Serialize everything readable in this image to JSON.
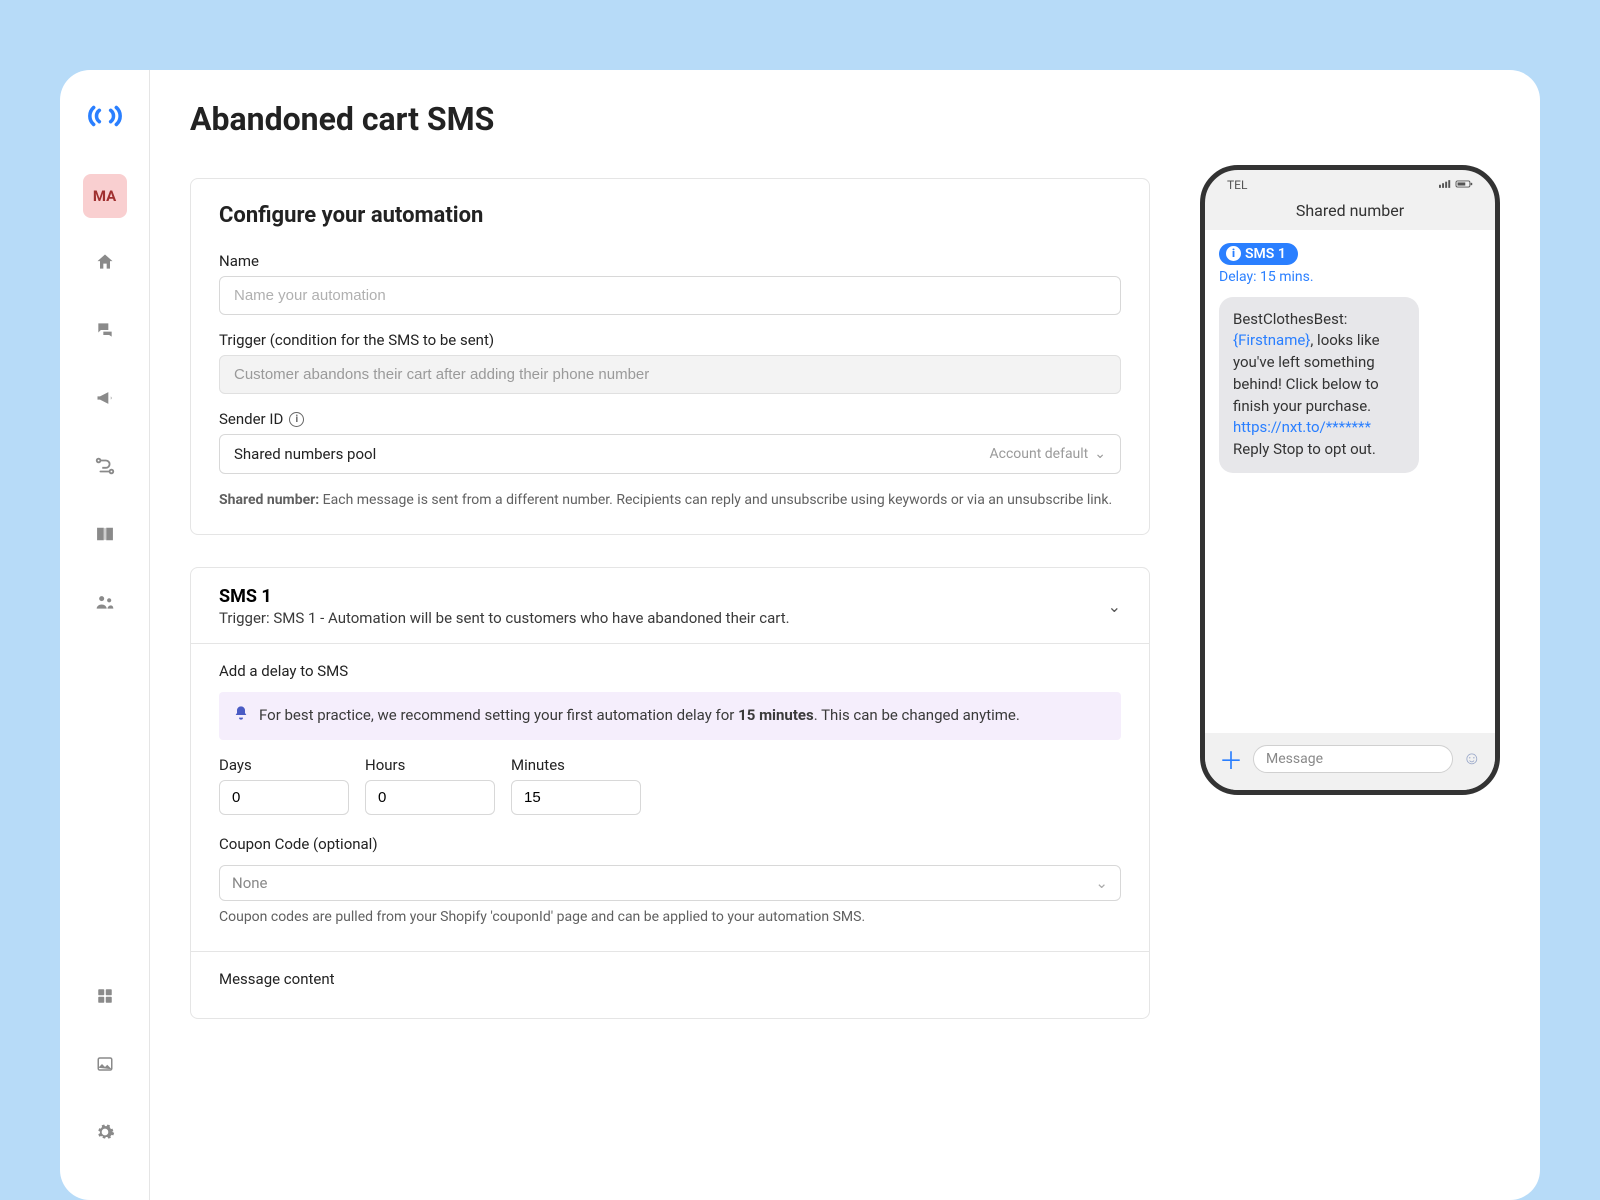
{
  "sidebar": {
    "active_label": "MA"
  },
  "page_title": "Abandoned cart SMS",
  "config": {
    "card_title": "Configure your automation",
    "name_label": "Name",
    "name_placeholder": "Name your automation",
    "trigger_label": "Trigger (condition for the SMS to be sent)",
    "trigger_value": "Customer abandons their cart after adding their phone number",
    "sender_label": "Sender ID",
    "sender_value": "Shared numbers pool",
    "sender_suffix": "Account default",
    "sender_helper_strong": "Shared number:",
    "sender_helper_rest": " Each message is sent from a different number. Recipients can reply and unsubscribe using keywords or via an unsubscribe link."
  },
  "sms1": {
    "title": "SMS 1",
    "subtitle": "Trigger: SMS 1 - Automation will be sent to customers who have abandoned their cart.",
    "delay_section_label": "Add a delay to SMS",
    "info_pre": "For best practice, we recommend setting your first automation delay for ",
    "info_bold": "15 minutes",
    "info_post": ". This can be changed anytime.",
    "days_label": "Days",
    "hours_label": "Hours",
    "minutes_label": "Minutes",
    "days_value": "0",
    "hours_value": "0",
    "minutes_value": "15",
    "coupon_label": "Coupon Code (optional)",
    "coupon_value": "None",
    "coupon_helper": "Coupon codes are pulled from your Shopify 'couponId' page and can be applied to your automation SMS.",
    "message_content_label": "Message content"
  },
  "preview": {
    "carrier": "TEL",
    "header": "Shared number",
    "badge": "SMS 1",
    "delay": "Delay: 15 mins.",
    "line1": "BestClothesBest:",
    "var": "{Firstname}",
    "body_rest": ", looks like you've left something behind! Click below to finish your purchase.",
    "link": "https://nxt.to/*******",
    "footer": "Reply Stop to opt out.",
    "input_placeholder": "Message"
  }
}
